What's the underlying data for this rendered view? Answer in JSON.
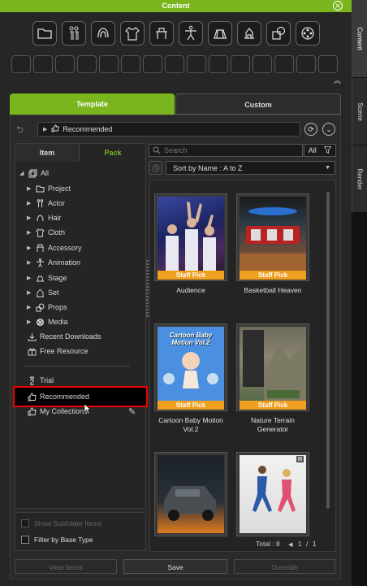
{
  "window": {
    "title": "Content"
  },
  "side_tabs": [
    {
      "label": "Content",
      "active": true
    },
    {
      "label": "Scene",
      "active": false
    },
    {
      "label": "Render",
      "active": false
    }
  ],
  "category_icons": [
    "folder-icon",
    "actor-pair-icon",
    "hair-icon",
    "cloth-icon",
    "accessory-icon",
    "animation-icon",
    "stage-icon",
    "set-icon",
    "props-icon",
    "media-icon"
  ],
  "tabs": {
    "template": "Template",
    "custom": "Custom"
  },
  "breadcrumb": {
    "label": "Recommended"
  },
  "subtabs": {
    "item": "Item",
    "pack": "Pack"
  },
  "tree": {
    "root": "All",
    "items": [
      {
        "label": "Project",
        "icon": "folder-icon"
      },
      {
        "label": "Actor",
        "icon": "actor-icon"
      },
      {
        "label": "Hair",
        "icon": "hair-icon"
      },
      {
        "label": "Cloth",
        "icon": "cloth-icon"
      },
      {
        "label": "Accessory",
        "icon": "accessory-icon"
      },
      {
        "label": "Animation",
        "icon": "animation-icon"
      },
      {
        "label": "Stage",
        "icon": "stage-icon"
      },
      {
        "label": "Set",
        "icon": "set-icon"
      },
      {
        "label": "Props",
        "icon": "props-icon"
      },
      {
        "label": "Media",
        "icon": "media-icon"
      }
    ],
    "recent_downloads": "Recent Downloads",
    "free_resource": "Free Resource",
    "trial": "Trial",
    "recommended": "Recommended",
    "my_collections": "My Collections"
  },
  "search": {
    "placeholder": "Search",
    "filter_label": "All"
  },
  "sort": {
    "label": "Sort by Name : A to Z"
  },
  "thumbnails": [
    {
      "label": "Audience",
      "badge": "Staff Pick"
    },
    {
      "label": "Basketball Heaven",
      "badge": "Staff Pick"
    },
    {
      "label": "Cartoon Baby Motion Vol.2",
      "badge": "Staff Pick",
      "art_text": "Cartoon Baby Motion Vol.2"
    },
    {
      "label": "Nature Terrain Generator",
      "badge": "Staff Pick"
    },
    {
      "label": "",
      "badge": ""
    },
    {
      "label": "",
      "badge": ""
    }
  ],
  "pager": {
    "total": "Total : 8",
    "current": "1",
    "separator": "/",
    "pages": "1"
  },
  "options": {
    "show_subfolder": "Show Subfolder Items",
    "filter_base": "Filter by Base Type"
  },
  "footer": {
    "view_items": "View Items",
    "save": "Save",
    "override": "Override"
  },
  "colors": {
    "accent": "#7ab51d",
    "badge": "#f0a01e",
    "selection_outline": "#e00000"
  }
}
